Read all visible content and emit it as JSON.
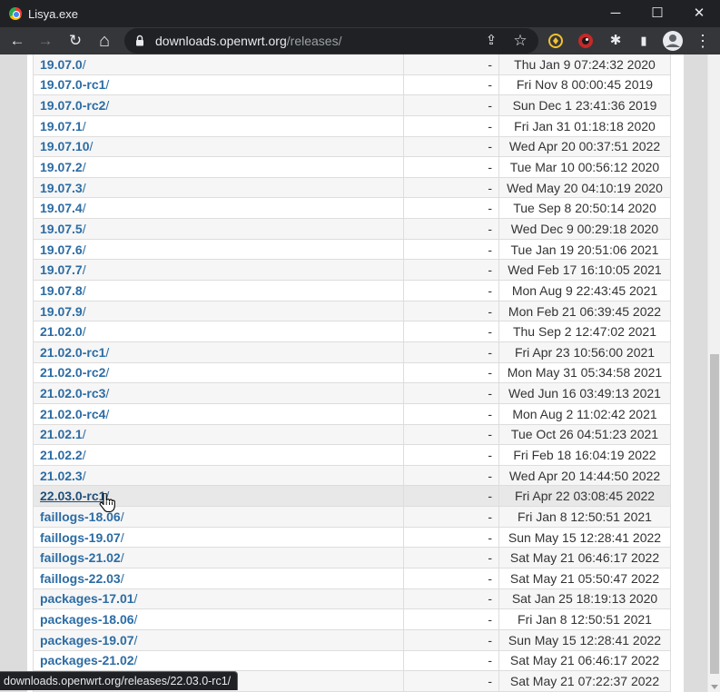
{
  "window": {
    "title": "Lisya.exe",
    "minimize_glyph": "─",
    "maximize_glyph": "☐",
    "close_glyph": "✕"
  },
  "toolbar": {
    "back_icon": "←",
    "forward_icon": "→",
    "reload_icon": "↻",
    "home_icon": "⌂",
    "url_host": "downloads.openwrt.org",
    "url_path": "/releases/",
    "share_icon": "⇪",
    "star_icon": "☆",
    "puzzle_icon": "✱",
    "sidepanel_icon": "▮",
    "menu_icon": "⋮"
  },
  "listing": {
    "rows": [
      {
        "name": "19.07.0",
        "slash": "/",
        "size": "-",
        "date": "Thu Jan 9 07:24:32 2020"
      },
      {
        "name": "19.07.0-rc1",
        "slash": "/",
        "size": "-",
        "date": "Fri Nov 8 00:00:45 2019"
      },
      {
        "name": "19.07.0-rc2",
        "slash": "/",
        "size": "-",
        "date": "Sun Dec 1 23:41:36 2019"
      },
      {
        "name": "19.07.1",
        "slash": "/",
        "size": "-",
        "date": "Fri Jan 31 01:18:18 2020"
      },
      {
        "name": "19.07.10",
        "slash": "/",
        "size": "-",
        "date": "Wed Apr 20 00:37:51 2022"
      },
      {
        "name": "19.07.2",
        "slash": "/",
        "size": "-",
        "date": "Tue Mar 10 00:56:12 2020"
      },
      {
        "name": "19.07.3",
        "slash": "/",
        "size": "-",
        "date": "Wed May 20 04:10:19 2020"
      },
      {
        "name": "19.07.4",
        "slash": "/",
        "size": "-",
        "date": "Tue Sep 8 20:50:14 2020"
      },
      {
        "name": "19.07.5",
        "slash": "/",
        "size": "-",
        "date": "Wed Dec 9 00:29:18 2020"
      },
      {
        "name": "19.07.6",
        "slash": "/",
        "size": "-",
        "date": "Tue Jan 19 20:51:06 2021"
      },
      {
        "name": "19.07.7",
        "slash": "/",
        "size": "-",
        "date": "Wed Feb 17 16:10:05 2021"
      },
      {
        "name": "19.07.8",
        "slash": "/",
        "size": "-",
        "date": "Mon Aug 9 22:43:45 2021"
      },
      {
        "name": "19.07.9",
        "slash": "/",
        "size": "-",
        "date": "Mon Feb 21 06:39:45 2022"
      },
      {
        "name": "21.02.0",
        "slash": "/",
        "size": "-",
        "date": "Thu Sep 2 12:47:02 2021"
      },
      {
        "name": "21.02.0-rc1",
        "slash": "/",
        "size": "-",
        "date": "Fri Apr 23 10:56:00 2021"
      },
      {
        "name": "21.02.0-rc2",
        "slash": "/",
        "size": "-",
        "date": "Mon May 31 05:34:58 2021"
      },
      {
        "name": "21.02.0-rc3",
        "slash": "/",
        "size": "-",
        "date": "Wed Jun 16 03:49:13 2021"
      },
      {
        "name": "21.02.0-rc4",
        "slash": "/",
        "size": "-",
        "date": "Mon Aug 2 11:02:42 2021"
      },
      {
        "name": "21.02.1",
        "slash": "/",
        "size": "-",
        "date": "Tue Oct 26 04:51:23 2021"
      },
      {
        "name": "21.02.2",
        "slash": "/",
        "size": "-",
        "date": "Fri Feb 18 16:04:19 2022"
      },
      {
        "name": "21.02.3",
        "slash": "/",
        "size": "-",
        "date": "Wed Apr 20 14:44:50 2022"
      },
      {
        "name": "22.03.0-rc1",
        "slash": "/",
        "size": "-",
        "date": "Fri Apr 22 03:08:45 2022"
      },
      {
        "name": "faillogs-18.06",
        "slash": "/",
        "size": "-",
        "date": "Fri Jan 8 12:50:51 2021"
      },
      {
        "name": "faillogs-19.07",
        "slash": "/",
        "size": "-",
        "date": "Sun May 15 12:28:41 2022"
      },
      {
        "name": "faillogs-21.02",
        "slash": "/",
        "size": "-",
        "date": "Sat May 21 06:46:17 2022"
      },
      {
        "name": "faillogs-22.03",
        "slash": "/",
        "size": "-",
        "date": "Sat May 21 05:50:47 2022"
      },
      {
        "name": "packages-17.01",
        "slash": "/",
        "size": "-",
        "date": "Sat Jan 25 18:19:13 2020"
      },
      {
        "name": "packages-18.06",
        "slash": "/",
        "size": "-",
        "date": "Fri Jan 8 12:50:51 2021"
      },
      {
        "name": "packages-19.07",
        "slash": "/",
        "size": "-",
        "date": "Sun May 15 12:28:41 2022"
      },
      {
        "name": "packages-21.02",
        "slash": "/",
        "size": "-",
        "date": "Sat May 21 06:46:17 2022"
      },
      {
        "name": "",
        "slash": "",
        "size": "-",
        "date": "Sat May 21 07:22:37 2022"
      }
    ],
    "hovered_row": 21
  },
  "status": {
    "link_url": "downloads.openwrt.org/releases/22.03.0-rc1/"
  },
  "colors": {
    "link": "#2c6ca4",
    "chrome_dark": "#202124",
    "toolbar": "#35363a"
  }
}
